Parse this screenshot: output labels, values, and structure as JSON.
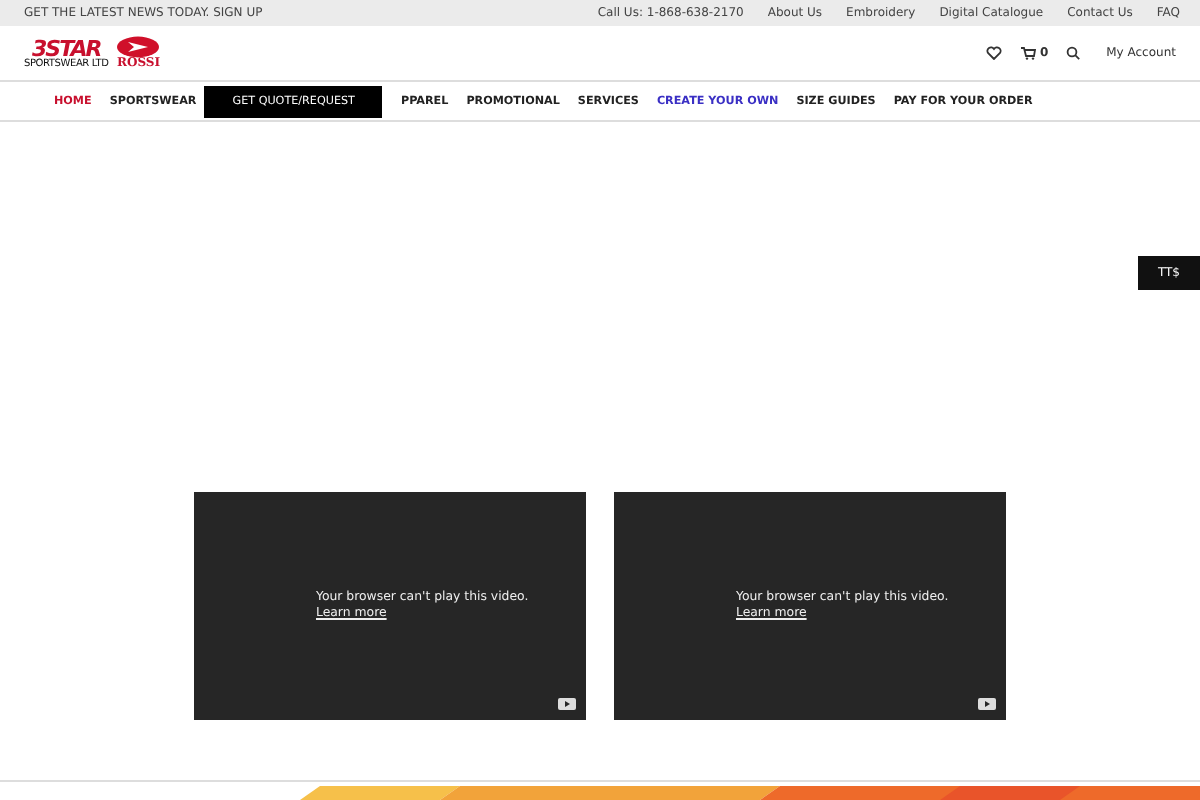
{
  "top_bar": {
    "news": "GET THE LATEST NEWS TODAY. SIGN UP",
    "links": [
      "Call Us: 1-868-638-2170",
      "About Us",
      "Embroidery",
      "Digital Catalogue",
      "Contact Us",
      "FAQ"
    ]
  },
  "header": {
    "logo": {
      "main": "3STAR",
      "sub": "SPORTSWEAR LTD",
      "brand": "ROSSI"
    },
    "cart_count": "0",
    "account": "My Account"
  },
  "nav": [
    {
      "label": "HOME",
      "selected": true,
      "highlighted": false
    },
    {
      "label": "SPORTSWEAR",
      "selected": false,
      "highlighted": false
    },
    {
      "label": "GET QUOTE/REQUEST",
      "kind": "button"
    },
    {
      "label": "PPAREL",
      "selected": false,
      "highlighted": false
    },
    {
      "label": "PROMOTIONAL",
      "selected": false,
      "highlighted": false
    },
    {
      "label": "SERVICES",
      "selected": false,
      "highlighted": false
    },
    {
      "label": "CREATE YOUR OWN",
      "selected": false,
      "highlighted": true
    },
    {
      "label": "SIZE GUIDES",
      "selected": false,
      "highlighted": false
    },
    {
      "label": "PAY FOR YOUR ORDER",
      "selected": false,
      "highlighted": false
    }
  ],
  "currency": "TT$",
  "videos": [
    {
      "message": "Your browser can't play this video.",
      "link": "Learn more"
    },
    {
      "message": "Your browser can't play this video.",
      "link": "Learn more"
    }
  ]
}
